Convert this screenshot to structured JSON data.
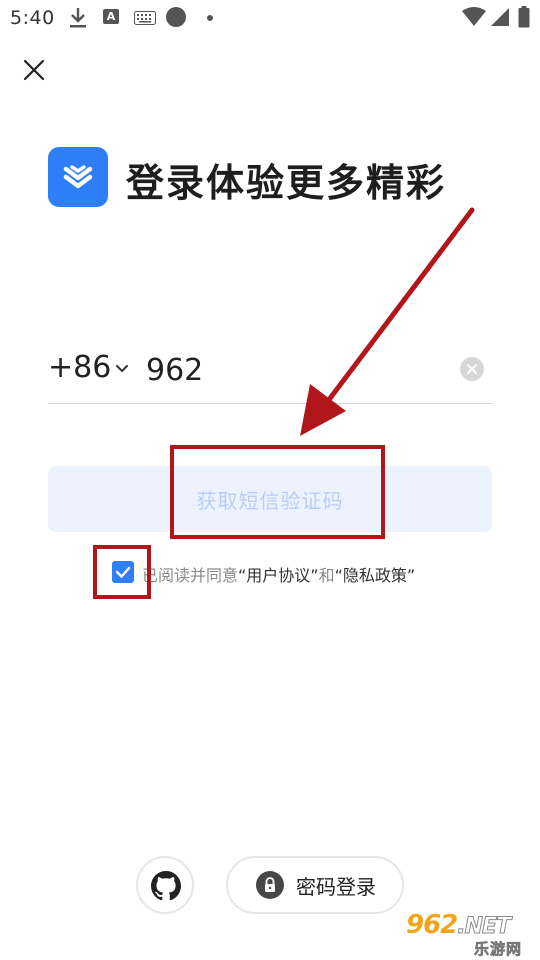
{
  "status_bar": {
    "time": "5:40",
    "keyboard_letter": "A"
  },
  "icons": {
    "close": "close-icon",
    "logo": "layers-chevron-icon",
    "chevron": "chevron-down-icon",
    "clear": "clear-circle-icon",
    "checkbox": "checkmark-icon",
    "github": "github-icon",
    "lock": "lock-icon"
  },
  "header": {
    "title": "登录体验更多精彩"
  },
  "phone": {
    "country_code": "+86",
    "value": "962"
  },
  "verify_button": {
    "label": "获取短信验证码"
  },
  "agreement": {
    "checked": true,
    "prefix": "已阅读并同意",
    "user_agreement": "“用户协议”",
    "conjunction": "和",
    "privacy_policy": "“隐私政策”"
  },
  "bottom": {
    "password_login_label": "密码登录"
  },
  "watermark": {
    "main": "962",
    "suffix": ".NET",
    "sub": "乐游网"
  },
  "colors": {
    "brand": "#2d7ef7",
    "annotation": "#b1171a",
    "verify_disabled_bg": "#edf3fe",
    "verify_disabled_text": "#b8cdf7"
  }
}
